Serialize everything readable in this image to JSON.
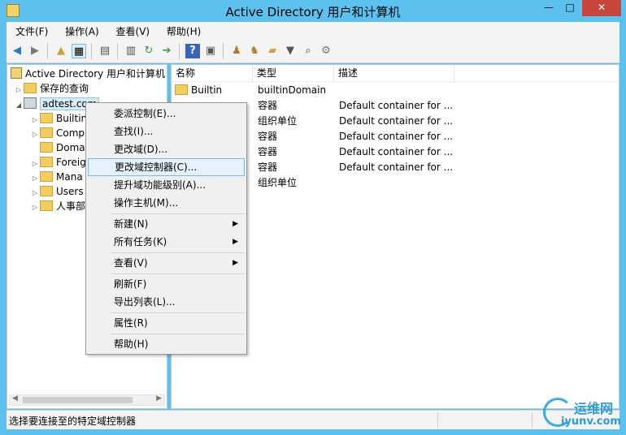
{
  "window": {
    "title": "Active Directory 用户和计算机",
    "controls": {
      "minimize": "—",
      "maximize": "□",
      "close": "✕"
    }
  },
  "menubar": [
    "文件(F)",
    "操作(A)",
    "查看(V)",
    "帮助(H)"
  ],
  "toolbar": {
    "icons": [
      "back-icon",
      "forward-icon",
      "up-folder-icon",
      "show-console-tree-icon",
      "properties-icon",
      "export-list-icon",
      "refresh-icon",
      "export-icon",
      "help-icon",
      "action-pane-icon",
      "new-user-icon",
      "new-group-icon",
      "new-ou-icon",
      "filter-icon",
      "find-icon",
      "add-to-group-icon"
    ]
  },
  "tree": {
    "root": "Active Directory 用户和计算机",
    "saved_queries": "保存的查询",
    "domain": "adtest.com",
    "children": [
      "Builtin",
      "Comp",
      "Doma",
      "Foreig",
      "Mana",
      "Users",
      "人事部"
    ]
  },
  "list": {
    "columns": [
      "名称",
      "类型",
      "描述"
    ],
    "rows": [
      {
        "name": "Builtin",
        "type": "builtinDomain",
        "desc": ""
      },
      {
        "name": "",
        "type": "容器",
        "desc": "Default container for ..."
      },
      {
        "name": "",
        "type": "组织单位",
        "desc": "Default container for ..."
      },
      {
        "name": "",
        "type": "容器",
        "desc": "Default container for ..."
      },
      {
        "name": "",
        "type": "容器",
        "desc": "Default container for ..."
      },
      {
        "name": "",
        "type": "容器",
        "desc": "Default container for ..."
      },
      {
        "name": "",
        "type": "组织单位",
        "desc": ""
      }
    ]
  },
  "context_menu": {
    "items": [
      {
        "label": "委派控制(E)..."
      },
      {
        "label": "查找(I)..."
      },
      {
        "label": "更改域(D)..."
      },
      {
        "label": "更改域控制器(C)...",
        "highlighted": true
      },
      {
        "label": "提升域功能级别(A)..."
      },
      {
        "label": "操作主机(M)..."
      },
      {
        "label": "新建(N)",
        "submenu": true
      },
      {
        "label": "所有任务(K)",
        "submenu": true
      },
      {
        "label": "查看(V)",
        "submenu": true
      },
      {
        "label": "刷新(F)"
      },
      {
        "label": "导出列表(L)..."
      },
      {
        "label": "属性(R)"
      },
      {
        "label": "帮助(H)"
      }
    ]
  },
  "status": {
    "text": "选择要连接至的特定域控制器"
  },
  "watermark": {
    "line1": "运维网",
    "line2": "iyunv.com"
  },
  "colors": {
    "titlebar": "#5dc1ef",
    "close": "#c7453b",
    "highlight": "#e5f1fb",
    "highlight_border": "#7eb4ea"
  }
}
